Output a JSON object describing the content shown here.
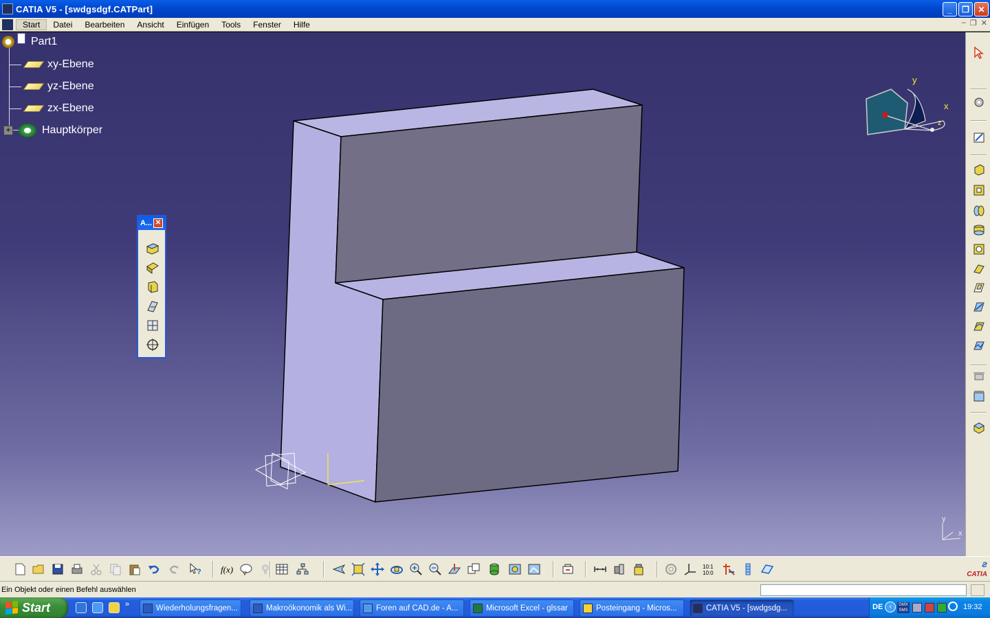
{
  "window": {
    "title": "CATIA V5 - [swdgsdgf.CATPart]"
  },
  "menu": {
    "items": [
      "Start",
      "Datei",
      "Bearbeiten",
      "Ansicht",
      "Einfügen",
      "Tools",
      "Fenster",
      "Hilfe"
    ]
  },
  "tree": {
    "root": "Part1",
    "items": [
      "xy-Ebene",
      "yz-Ebene",
      "zx-Ebene"
    ],
    "body": "Hauptkörper"
  },
  "palette": {
    "title": "A..."
  },
  "compass": {
    "x_label": "x",
    "y_label": "y",
    "z_label": "z"
  },
  "axis_corner": {
    "x_label": "x",
    "y_label": "y"
  },
  "status": {
    "message": "Ein Objekt oder einen Befehl auswählen"
  },
  "taskbar": {
    "start_label": "Start",
    "tasks": [
      "Wiederholungsfragen...",
      "Makroökonomik als Wi...",
      "Foren auf CAD.de - A...",
      "Microsoft Excel - glssar",
      "Posteingang - Micros...",
      "CATIA V5 - [swdgsdg..."
    ],
    "lang": "DE",
    "clock": "19:32"
  },
  "colors": {
    "titlebar": "#0048d0",
    "viewport_top": "#36326d",
    "viewport_bottom": "#9d9cc6",
    "solid_light": "#b8b5e6",
    "solid_dark": "#6e6c86"
  }
}
